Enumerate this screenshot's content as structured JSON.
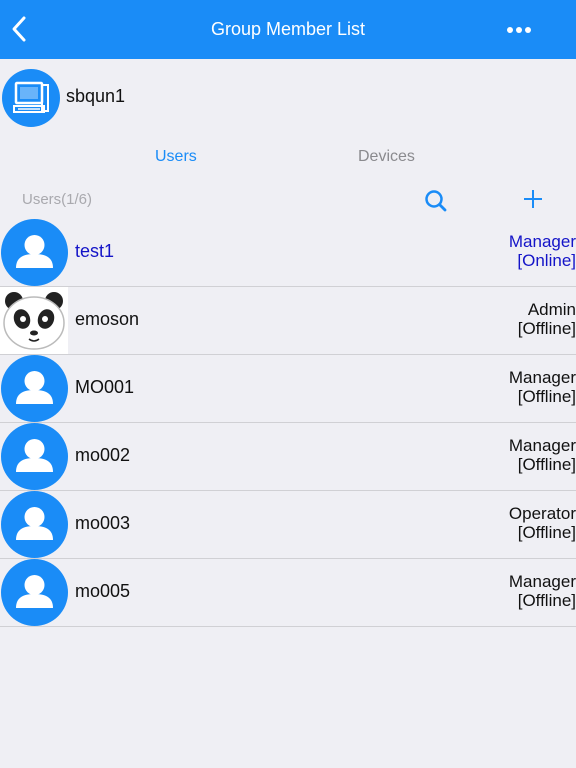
{
  "navbar": {
    "title": "Group Member List",
    "back_icon": "chevron-left-icon",
    "more_icon": "more-dots-icon",
    "background": "#1a8cf7"
  },
  "group": {
    "name": "sbqun1",
    "icon": "computer-icon"
  },
  "tabs": [
    {
      "label": "Users",
      "active": true
    },
    {
      "label": "Devices",
      "active": false
    }
  ],
  "list_header": {
    "count_label": "Users(1/6)",
    "search_icon": "search-icon",
    "add_icon": "plus-icon"
  },
  "users": [
    {
      "name": "test1",
      "role": "Manager",
      "status": "[Online]",
      "avatar": "user-silhouette-icon",
      "online": true
    },
    {
      "name": "emoson",
      "role": "Admin",
      "status": "[Offline]",
      "avatar": "panda-avatar",
      "online": false
    },
    {
      "name": "MO001",
      "role": "Manager",
      "status": "[Offline]",
      "avatar": "user-silhouette-icon",
      "online": false
    },
    {
      "name": "mo002",
      "role": "Manager",
      "status": "[Offline]",
      "avatar": "user-silhouette-icon",
      "online": false
    },
    {
      "name": "mo003",
      "role": "Operator",
      "status": "[Offline]",
      "avatar": "user-silhouette-icon",
      "online": false
    },
    {
      "name": "mo005",
      "role": "Manager",
      "status": "[Offline]",
      "avatar": "user-silhouette-icon",
      "online": false
    }
  ],
  "colors": {
    "accent": "#1a8cf7",
    "online_text": "#1414c8",
    "muted_text": "#a9a9ae",
    "background": "#efeff4"
  }
}
